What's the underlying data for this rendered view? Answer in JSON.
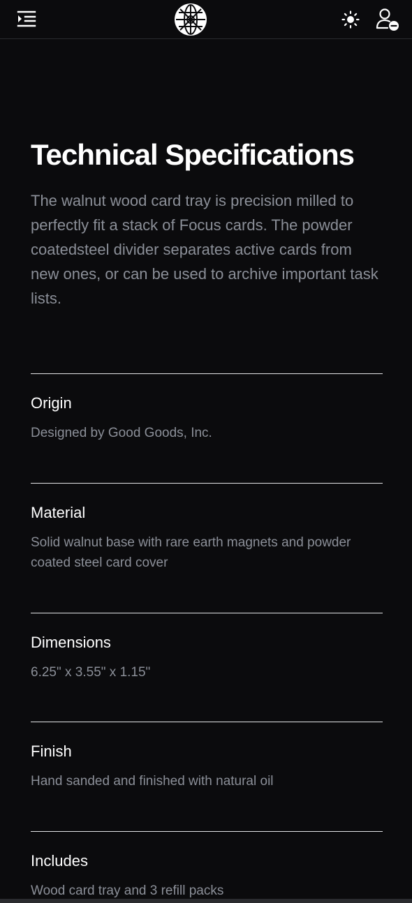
{
  "header": {
    "menu_icon": "menu-indent-icon",
    "logo_icon": "globe-logo-icon",
    "theme_icon": "sun-icon",
    "user_icon": "user-remove-icon"
  },
  "main": {
    "title": "Technical Specifications",
    "intro": "The walnut wood card tray is precision milled to perfectly fit a stack of Focus cards. The powder coatedsteel divider separates active cards from new ones, or can be used to archive important task lists.",
    "specs": [
      {
        "label": "Origin",
        "value": "Designed by Good Goods, Inc."
      },
      {
        "label": "Material",
        "value": "Solid walnut base with rare earth magnets and powder coated steel card cover"
      },
      {
        "label": "Dimensions",
        "value": "6.25\" x 3.55\" x 1.15\""
      },
      {
        "label": "Finish",
        "value": "Hand sanded and finished with natural oil"
      },
      {
        "label": "Includes",
        "value": "Wood card tray and 3 refill packs"
      }
    ]
  },
  "colors": {
    "background": "#0b0b0d",
    "text_primary": "#ffffff",
    "text_muted": "#8b8f98",
    "divider": "#e5e6e8"
  }
}
